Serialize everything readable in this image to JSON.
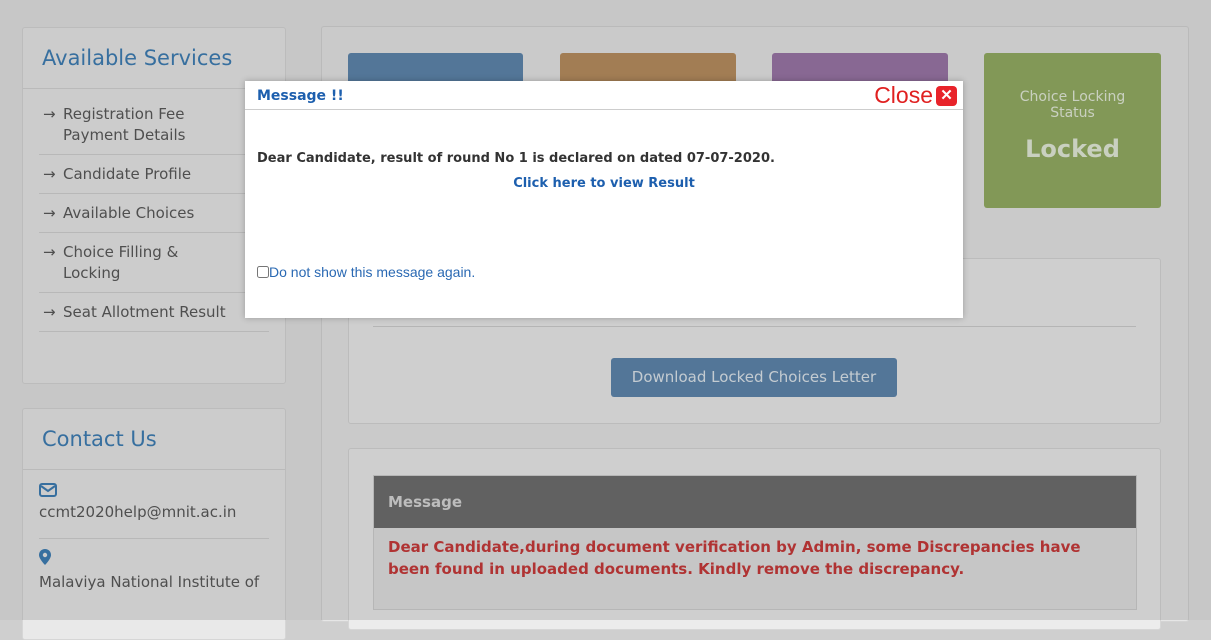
{
  "sidebar": {
    "services_title": "Available Services",
    "services": [
      {
        "label": "Registration Fee Payment Details"
      },
      {
        "label": "Candidate Profile"
      },
      {
        "label": "Available Choices"
      },
      {
        "label": "Choice Filling & Locking"
      },
      {
        "label": "Seat Allotment Result"
      }
    ],
    "contact_title": "Contact Us",
    "contact_email": "ccmt2020help@mnit.ac.in",
    "contact_address": "Malaviya National Institute of"
  },
  "tiles": [
    {
      "color": "#5f87ad"
    },
    {
      "color": "#b98f60"
    },
    {
      "color": "#9b77a8"
    },
    {
      "color": "#95ad63",
      "label": "Choice Locking Status",
      "value": "Locked"
    }
  ],
  "main": {
    "download_button": "Download Locked Choices Letter",
    "message_header": "Message",
    "message_text": "Dear Candidate,during document verification by Admin, some Discrepancies have been found in uploaded documents. Kindly remove the discrepancy."
  },
  "modal": {
    "title": "Message !!",
    "close_label": "Close",
    "body_text": "Dear Candidate, result of round No 1 is declared on dated 07-07-2020.",
    "link_text": "Click here to view Result",
    "checkbox_label": "Do not show this message again."
  }
}
